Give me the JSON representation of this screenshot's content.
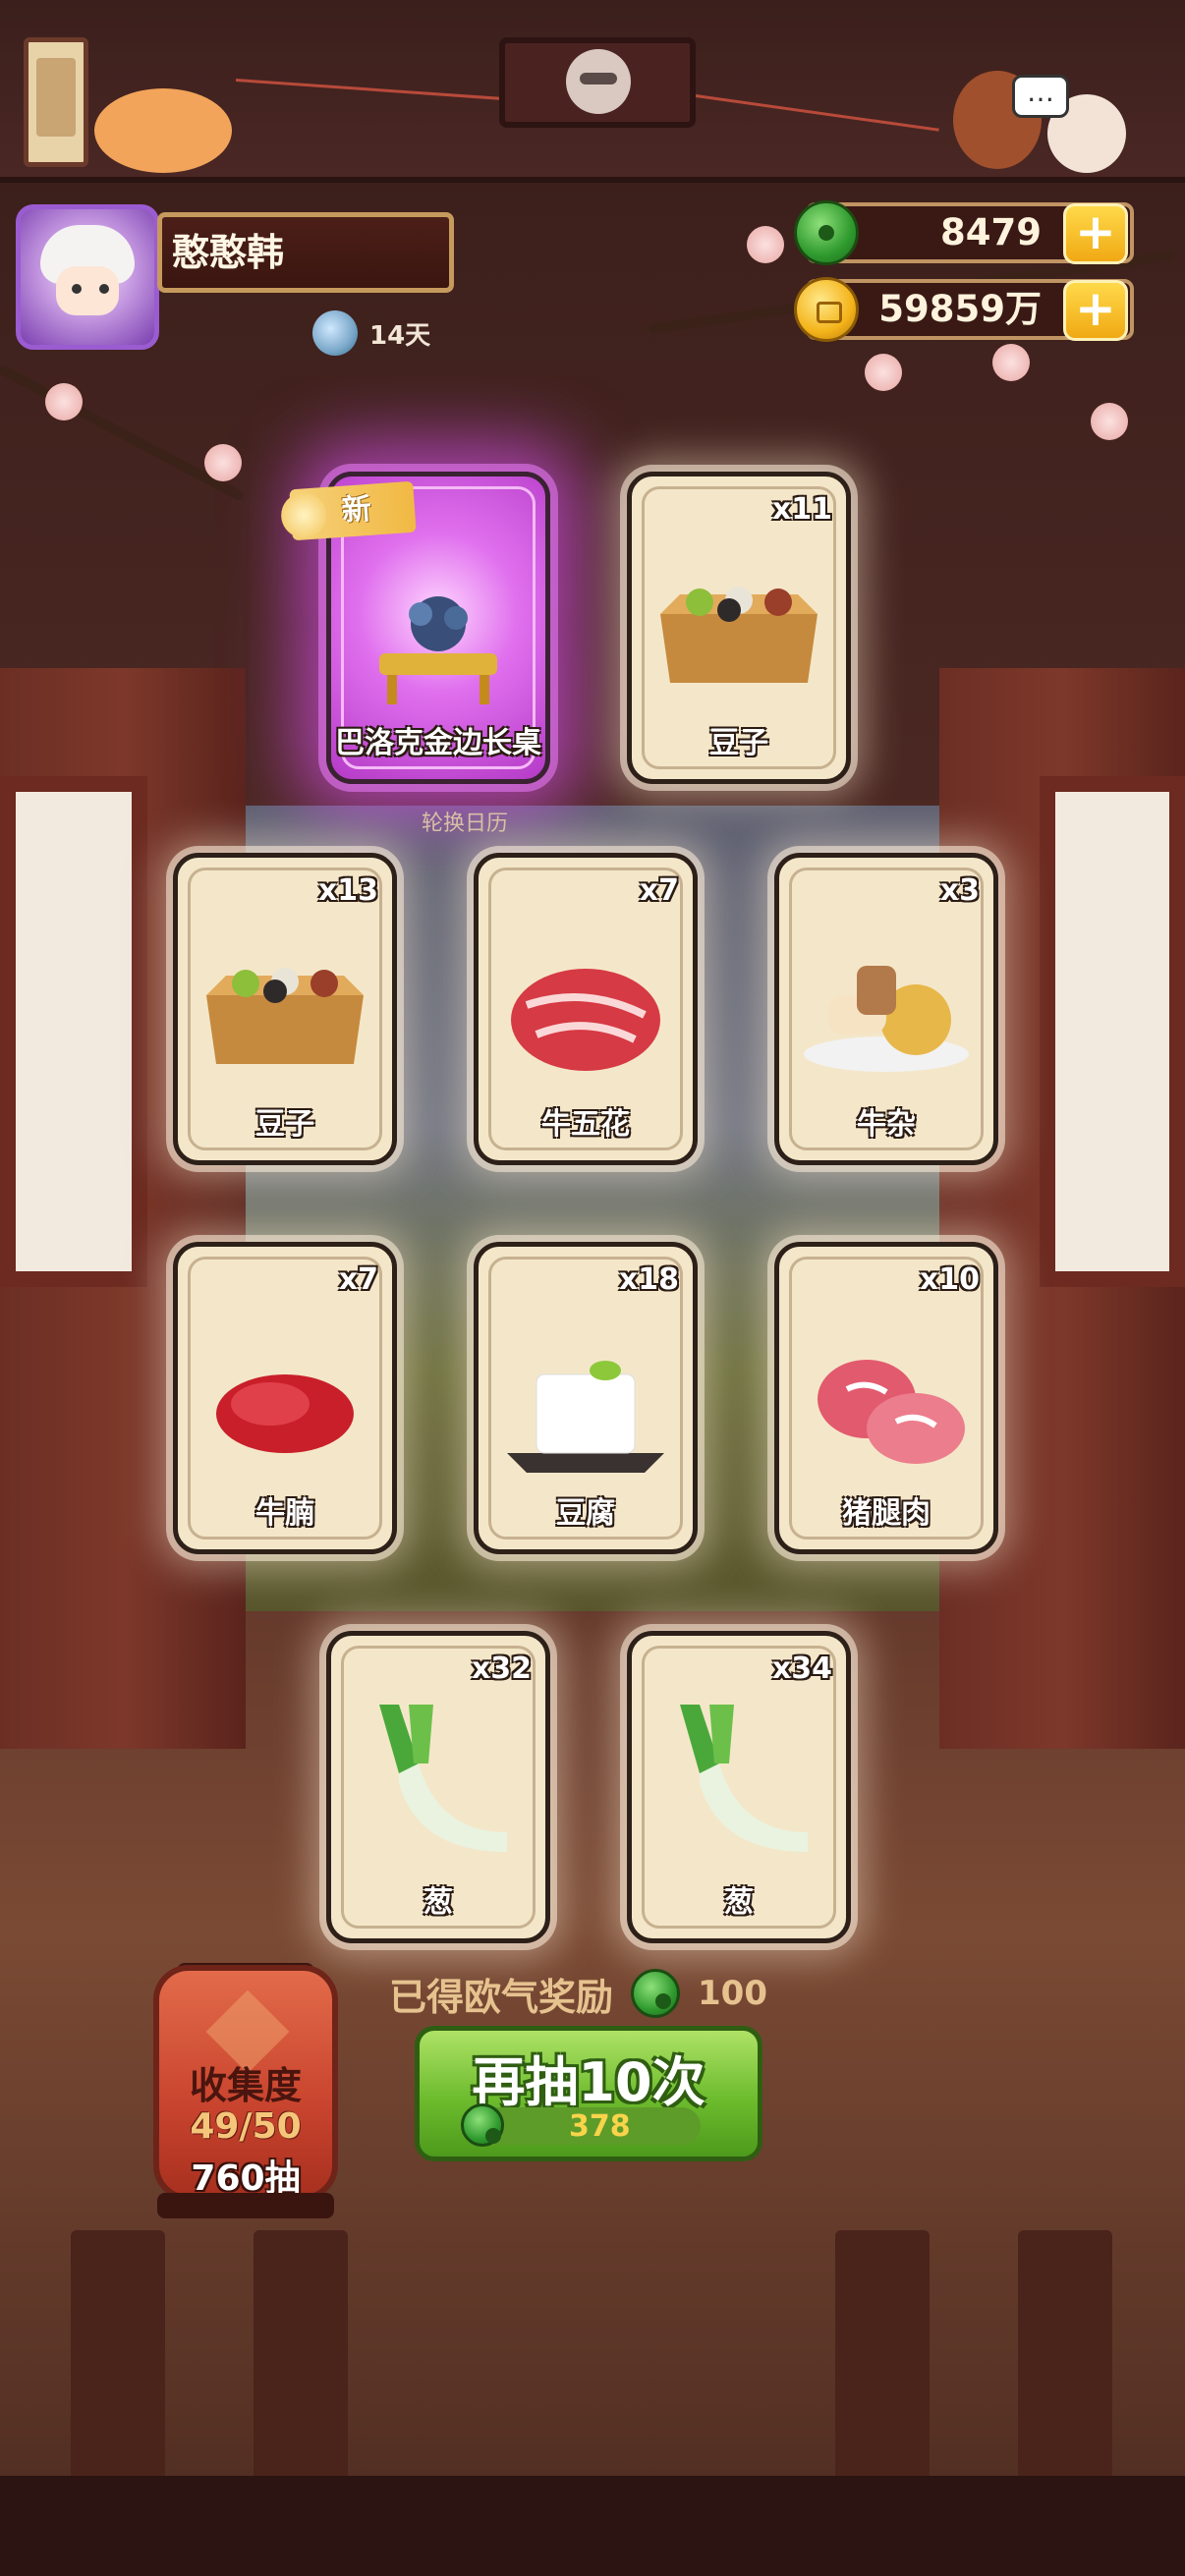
{
  "player": {
    "name": "憨憨韩",
    "days": "14天"
  },
  "currency": {
    "jade": "8479",
    "gold": "59859万"
  },
  "new_tag": "新",
  "calendar_label": "轮换日历",
  "cards": [
    {
      "label": "巴洛克金边长桌",
      "count": "",
      "special": true,
      "art": "table"
    },
    {
      "label": "豆子",
      "count": "x11",
      "art": "beans"
    },
    {
      "label": "豆子",
      "count": "x13",
      "art": "beans"
    },
    {
      "label": "牛五花",
      "count": "x7",
      "art": "beef"
    },
    {
      "label": "牛杂",
      "count": "x3",
      "art": "offal"
    },
    {
      "label": "牛腩",
      "count": "x7",
      "art": "brisket"
    },
    {
      "label": "豆腐",
      "count": "x18",
      "art": "tofu"
    },
    {
      "label": "猪腿肉",
      "count": "x10",
      "art": "pork"
    },
    {
      "label": "葱",
      "count": "x32",
      "art": "scallion"
    },
    {
      "label": "葱",
      "count": "x34",
      "art": "scallion"
    }
  ],
  "reward": {
    "label": "已得欧气奖励",
    "value": "100"
  },
  "collection": {
    "title": "收集度",
    "progress": "49/50",
    "draws": "760抽"
  },
  "draw_button": {
    "label": "再抽10次",
    "cost": "378"
  },
  "colors": {
    "accent_green": "#6cbb2d",
    "gold": "#f4b41a",
    "card_bg": "#f4e7c9",
    "special_purple": "#e070ee"
  }
}
